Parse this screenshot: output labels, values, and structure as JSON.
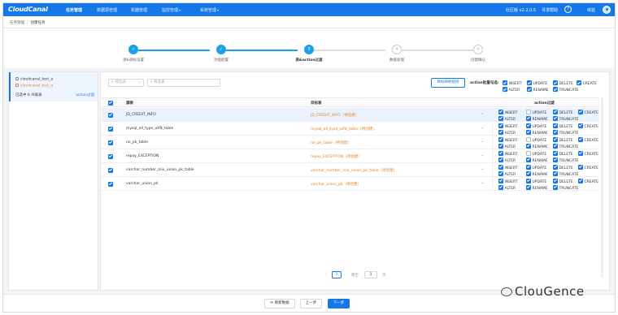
{
  "app": {
    "logo": "CloudCanal"
  },
  "nav": {
    "items": [
      "任务管理",
      "数据源管理",
      "机器管理",
      "监控管理",
      "系统管理"
    ],
    "version": "社区版 v2.2.0.5",
    "help": "寻求帮助",
    "user": "体验"
  },
  "breadcrumb": {
    "parent": "任务管理",
    "current": "创建任务"
  },
  "steps": [
    {
      "label": "源&目标设置",
      "status": "done"
    },
    {
      "label": "功能配置",
      "status": "done"
    },
    {
      "label": "表&action过滤",
      "status": "active",
      "number": "3"
    },
    {
      "label": "数据处理",
      "status": "todo",
      "number": "4"
    },
    {
      "label": "创建确认",
      "status": "todo",
      "number": "5"
    }
  ],
  "left_panel": {
    "source_db": "cloudcanal_test_a",
    "target_db": "cloudcanal_test_a",
    "selected_count": "已选中 6 /6张表",
    "action_filter_link": "action过滤"
  },
  "toolbar": {
    "select_placeholder": "筛选表",
    "search_placeholder": "筛选表",
    "map_rule_button": "目标映射规则",
    "batch_label": "action批量勾选:",
    "batch_options": [
      {
        "label": "INSERT",
        "checked": true
      },
      {
        "label": "UPDATE",
        "checked": true
      },
      {
        "label": "DELETE",
        "checked": true
      },
      {
        "label": "CREATE",
        "checked": true
      },
      {
        "label": "ALTER",
        "checked": true
      },
      {
        "label": "RENAME",
        "checked": true
      },
      {
        "label": "TRUNCATE",
        "checked": true
      }
    ]
  },
  "table": {
    "headers": {
      "source": "源表",
      "target": "目标表",
      "action": "action过滤"
    },
    "rows": [
      {
        "source": "JD_CREDIT_INFO",
        "target": "JD_CREDIT_INFO（待创建）",
        "checked": true,
        "highlight": true,
        "update_checked": false
      },
      {
        "source": "mysql_all_type_utf8_table",
        "target": "mysql_all_type_utf8_table（待创建）",
        "checked": true,
        "highlight": false,
        "update_checked": true
      },
      {
        "source": "no_pk_table",
        "target": "no_pk_table（待创建）",
        "checked": true,
        "highlight": false,
        "update_checked": false
      },
      {
        "source": "repay_EXCEPTION",
        "target": "repay_EXCEPTION（待创建）",
        "checked": true,
        "highlight": false,
        "update_checked": false
      },
      {
        "source": "varchar_number_mix_union_pk_table",
        "target": "varchar_number_mix_union_pk_table（待创建）",
        "checked": true,
        "highlight": false,
        "update_checked": true
      },
      {
        "source": "varchar_union_pk",
        "target": "varchar_union_pk（待创建）",
        "checked": true,
        "highlight": false,
        "update_checked": true
      }
    ],
    "actions": [
      "INSERT",
      "UPDATE",
      "DELETE",
      "CREATE",
      "ALTER",
      "RENAME",
      "TRUNCATE"
    ]
  },
  "pager": {
    "prev": "‹",
    "page": "1",
    "next": "›",
    "goto_label": "跳至",
    "goto_value": "1",
    "page_unit": "页"
  },
  "footer": {
    "refresh": "⟳ 刷新数据",
    "prev_step": "上一步",
    "next_step": "下一步"
  },
  "watermark": "ClouGence",
  "colors": {
    "primary": "#1677e8",
    "target": "#e8802b",
    "step": "#1ca0e8"
  }
}
